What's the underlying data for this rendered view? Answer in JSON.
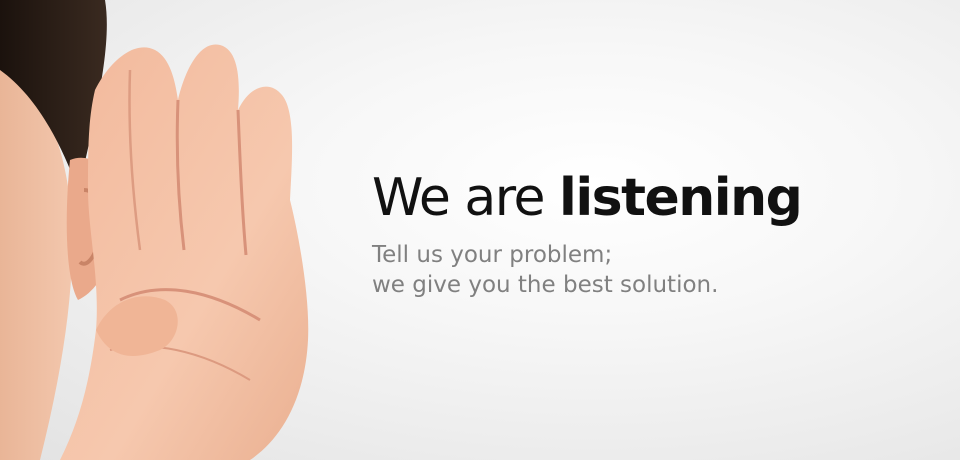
{
  "banner": {
    "headline": {
      "regular": "We are ",
      "emphasis": "listening"
    },
    "tagline": {
      "line1": "Tell us your problem;",
      "line2": "we give you the best solution."
    },
    "illustration": {
      "icon": "hand-cupped-to-ear-icon"
    },
    "colors": {
      "headline": "#111111",
      "tagline": "#808080",
      "background": "#f2f2f2"
    }
  }
}
